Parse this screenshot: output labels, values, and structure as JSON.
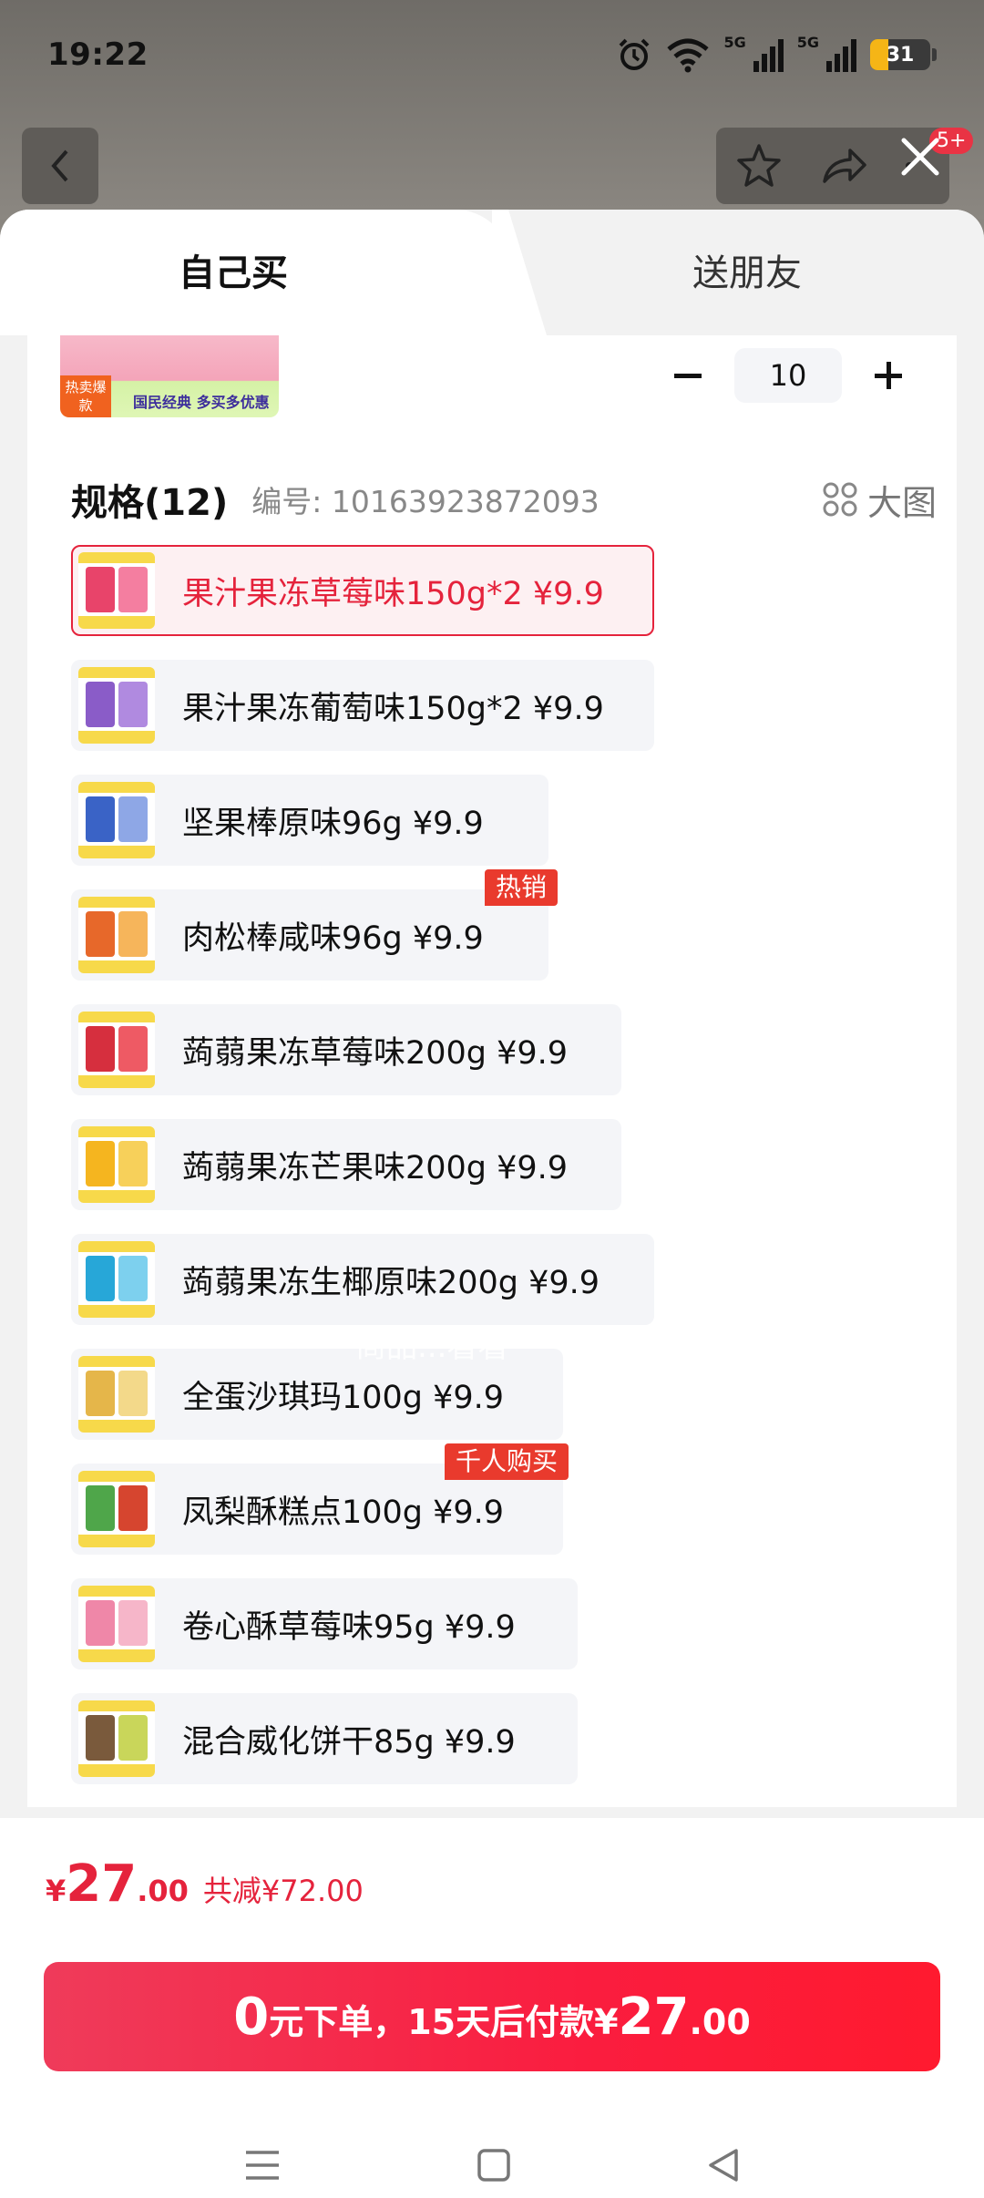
{
  "status": {
    "time": "19:22",
    "battery": "31",
    "net1": "5G",
    "net2": "5G"
  },
  "header": {
    "badge": "5+"
  },
  "tabs": {
    "self": "自己买",
    "friend": "送朋友"
  },
  "product": {
    "hot_tag": "热卖爆款",
    "slogan": "国民经典 多买多优惠",
    "quantity": "10"
  },
  "spec": {
    "title": "规格(12)",
    "code": "编号: 10163923872093",
    "big_image": "大图",
    "options": [
      {
        "label": "果汁果冻草莓味150g*2  ¥9.9",
        "selected": true,
        "c1": "#e8446a",
        "c2": "#f47ea0"
      },
      {
        "label": "果汁果冻葡萄味150g*2  ¥9.9",
        "selected": false,
        "c1": "#8a5cc8",
        "c2": "#b08ae0"
      },
      {
        "label": "坚果棒原味96g  ¥9.9",
        "selected": false,
        "c1": "#3a63c6",
        "c2": "#8ea7e6"
      },
      {
        "label": "肉松棒咸味96g  ¥9.9",
        "selected": false,
        "c1": "#e7682a",
        "c2": "#f6b55b",
        "tag": "热销"
      },
      {
        "label": "蒟蒻果冻草莓味200g  ¥9.9",
        "selected": false,
        "c1": "#d62f3e",
        "c2": "#ee5a64"
      },
      {
        "label": "蒟蒻果冻芒果味200g  ¥9.9",
        "selected": false,
        "c1": "#f5b51f",
        "c2": "#f7d05a"
      },
      {
        "label": "蒟蒻果冻生椰原味200g  ¥9.9",
        "selected": false,
        "c1": "#27a7d8",
        "c2": "#7dd0ee"
      },
      {
        "label": "全蛋沙琪玛100g  ¥9.9",
        "selected": false,
        "c1": "#e5b64a",
        "c2": "#f3d98a"
      },
      {
        "label": "凤梨酥糕点100g  ¥9.9",
        "selected": false,
        "c1": "#4fa64a",
        "c2": "#d6452f",
        "tag": "千人购买"
      },
      {
        "label": "卷心酥草莓味95g  ¥9.9",
        "selected": false,
        "c1": "#ef87a8",
        "c2": "#f6b6c9"
      },
      {
        "label": "混合威化饼干85g  ¥9.9",
        "selected": false,
        "c1": "#7a5a3c",
        "c2": "#c9d65a"
      }
    ],
    "watermark": "商品...看看"
  },
  "price": {
    "yen": "¥",
    "integer": "27",
    "decimal": ".00",
    "savings": "共减¥72.00"
  },
  "pay": {
    "zero": "0",
    "text1": "元下单，15天后付款¥",
    "amount": "27",
    "decimal": ".00"
  }
}
